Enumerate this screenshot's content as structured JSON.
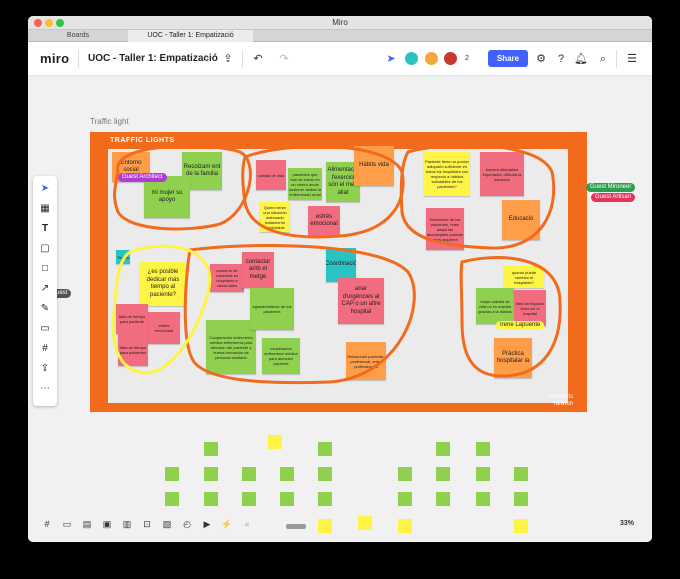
{
  "window": {
    "title": "Miro",
    "tabs": [
      "Boards",
      "UOC - Taller 1: Empatizació"
    ],
    "traffic_lights": {
      "close": "#ff5f57",
      "minimize": "#febc2e",
      "zoom": "#28c840"
    }
  },
  "topbar": {
    "logo": "miro",
    "board_title": "UOC - Taller 1: Empatizació",
    "star_icon": "☆",
    "upload_icon": "⇪",
    "undo_icon": "↶",
    "redo_icon": "↷",
    "cursor_icon": "➤",
    "avatar_count": "2",
    "share_label": "Share",
    "notification_count": "8"
  },
  "canvas": {
    "frame_label": "Traffic light",
    "frame_title": "TRAFFIC LIGHTS",
    "watermark_line1": "mindsets",
    "watermark_line2": "newton",
    "guest_side_label": "uest",
    "zoom": "33%"
  },
  "tags": {
    "guest_architect": "Guest Architect",
    "guest_mironeer": "Guest Mironeer",
    "guest_artisan": "Guest Artisan",
    "irene": "Irene Lapuente"
  },
  "notes": {
    "n1": "Entorno social",
    "n2": "Recolzam ent de la familia",
    "n3": "mi mujer su apoyo",
    "n4": "calidad de vida",
    "n5": "pacientes que han de iniciar en un centro acute sustener ambar la enfermedad renal",
    "n6": "Alimentació l'exercici són el meu aliat",
    "n7": "Hàbits vida",
    "n8": "Quiero tener una situación adecuado tratamiento controlable",
    "n9": "Paciente tiene un pocion adiquario suficiente en todos los hospitales con respecto a hábitos saludables de los pacientes?",
    "n10": "barrera idiomàtica importants, dificulta la educació",
    "n11": "estrés emocional",
    "n12": "Desciende de los pacientes, hose adapt las aconsejable pnuede otros laquierre",
    "n13": "Educació",
    "n14": "Temps",
    "n15": "¿es posible dedicar más tiempo al paciente?",
    "n16": "aumento de consultas en hospitales a causa altos",
    "n17": "contactar amb el metge",
    "n18": "Coordinació",
    "n19": "anar d'urgències al CAP o un altre hospital",
    "n20": "quanto puede cambiar el trasplante?",
    "n21": "mejor calidad de vida no es manido gracias a la diàlisis",
    "n22": "falta de espacio físico en el hospital",
    "n23": "falta de tiempo para paciente",
    "n24": "estrés emocional",
    "n25": "falta de tiempo para pacientes",
    "n26": "Cooperación enfermería médica enfermería para atención del paciente y buena formación de personal sanitario",
    "n27": "agradecimiento de los pacientes",
    "n28": "cooperación enfermería médica para atención paciente",
    "n29": "Relaciones paciente-profesional, entre professionals",
    "n30": "Pràctica hospitalar ia"
  },
  "colors": {
    "frame_orange": "#f26b1d",
    "note_pink": "#f16c7f",
    "note_green": "#8fd14f",
    "note_yellow": "#fef445",
    "note_orange": "#ff9d48",
    "note_teal": "#2ac3c4",
    "share_blue": "#4262ff",
    "tag_purple": "#b03bd6",
    "tag_green": "#2d9d4f",
    "tag_red": "#e5345b"
  }
}
